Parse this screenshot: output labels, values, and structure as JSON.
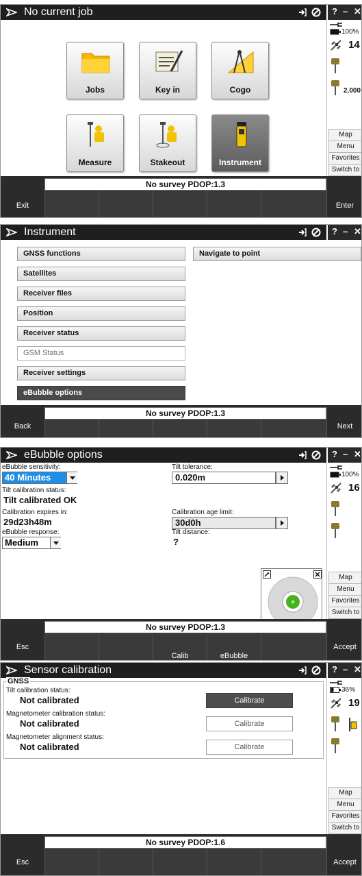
{
  "colors": {
    "titlebar": "#1f1f1f",
    "accent_blue": "#1e8fe8",
    "selected_dark": "#4a4a4a",
    "bubble_green": "#46b21e"
  },
  "window_controls": {
    "help": "?",
    "minimize": "–",
    "close": "✕"
  },
  "screen1": {
    "title": "No current job",
    "tiles": [
      {
        "label": "Jobs",
        "icon": "folder-icon"
      },
      {
        "label": "Key in",
        "icon": "keypad-icon"
      },
      {
        "label": "Cogo",
        "icon": "cogo-icon"
      },
      {
        "label": "Measure",
        "icon": "surveyor-icon"
      },
      {
        "label": "Stakeout",
        "icon": "stakeout-icon"
      },
      {
        "label": "Instrument",
        "icon": "receiver-icon"
      }
    ],
    "status": {
      "battery": "100%",
      "satellites": "14",
      "antenna_height": "2.000"
    },
    "side_buttons": [
      "Map",
      "Menu",
      "Favorites",
      "Switch to"
    ],
    "status_line": "No survey  PDOP:1.3",
    "softkey_left": "Exit",
    "softkey_right": "Enter"
  },
  "screen2": {
    "title": "Instrument",
    "menu_left": [
      {
        "label": "GNSS functions",
        "state": "normal"
      },
      {
        "label": "Satellites",
        "state": "normal"
      },
      {
        "label": "Receiver files",
        "state": "normal"
      },
      {
        "label": "Position",
        "state": "normal"
      },
      {
        "label": "Receiver status",
        "state": "normal"
      },
      {
        "label": "GSM Status",
        "state": "disabled"
      },
      {
        "label": "Receiver settings",
        "state": "normal"
      },
      {
        "label": "eBubble options",
        "state": "active"
      }
    ],
    "menu_right": [
      {
        "label": "Navigate to point",
        "state": "normal"
      }
    ],
    "status_line": "No survey  PDOP:1.3",
    "softkey_left": "Back",
    "softkey_right": "Next"
  },
  "screen3": {
    "title": "eBubble options",
    "sensitivity_label": "eBubble sensitivity:",
    "sensitivity_value": "40 Minutes",
    "tilt_status_label": "Tilt calibration status:",
    "tilt_status_value": "Tilt calibrated OK",
    "expires_label": "Calibration expires in:",
    "expires_value": "29d23h48m",
    "response_label": "eBubble response:",
    "response_value": "Medium",
    "tolerance_label": "Tilt tolerance:",
    "tolerance_value": "0.020m",
    "age_limit_label": "Calibration age limit:",
    "age_limit_value": "30d0h",
    "tilt_distance_label": "Tilt distance:",
    "tilt_distance_value": "?",
    "status": {
      "battery": "100%",
      "satellites": "16"
    },
    "side_buttons": [
      "Map",
      "Menu",
      "Favorites",
      "Switch to"
    ],
    "status_line": "No survey  PDOP:1.3",
    "softkeys_mid": [
      "Calib",
      "eBubble"
    ],
    "softkey_left": "Esc",
    "softkey_right": "Accept"
  },
  "screen4": {
    "title": "Sensor calibration",
    "group_title": "GNSS",
    "rows": [
      {
        "label": "Tilt calibration status:",
        "value": "Not calibrated",
        "button": "Calibrate",
        "enabled": true
      },
      {
        "label": "Magnetometer calibration status:",
        "value": "Not calibrated",
        "button": "Calibrate",
        "enabled": false
      },
      {
        "label": "Magnetometer alignment status:",
        "value": "Not calibrated",
        "button": "Calibrate",
        "enabled": false
      }
    ],
    "status": {
      "battery": "36%",
      "satellites": "19"
    },
    "side_buttons": [
      "Map",
      "Menu",
      "Favorites",
      "Switch to"
    ],
    "status_line": "No survey  PDOP:1.6",
    "softkey_left": "Esc",
    "softkey_right": "Accept"
  }
}
